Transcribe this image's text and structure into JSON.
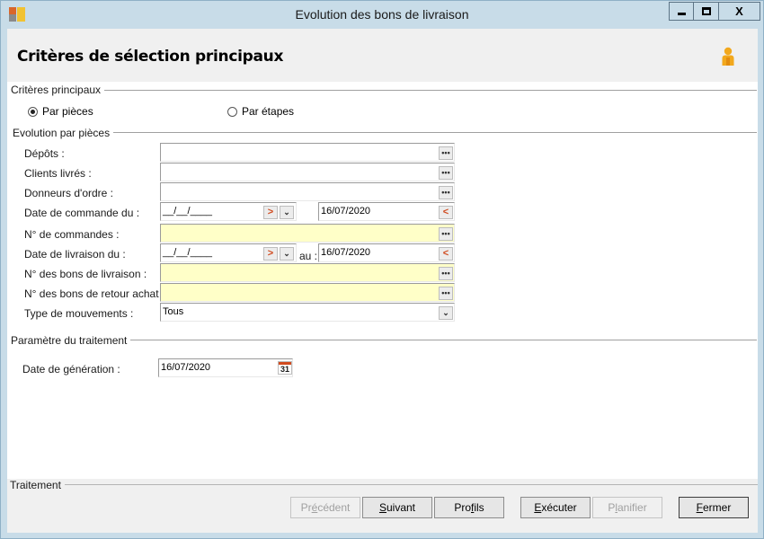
{
  "window": {
    "title": "Evolution des bons de livraison",
    "controls": {
      "minimize": "▬",
      "maximize": "☐",
      "close": "X"
    }
  },
  "header": {
    "title": "Critères de sélection principaux"
  },
  "sections": {
    "main": "Critères principaux",
    "pieces": "Evolution par pièces",
    "params": "Paramètre du traitement",
    "treatment": "Traitement"
  },
  "radios": {
    "par_pieces": {
      "label": "Par pièces",
      "checked": true
    },
    "par_etapes": {
      "label": "Par étapes",
      "checked": false
    }
  },
  "form": {
    "depots": {
      "label": "Dépôts :",
      "value": ""
    },
    "clients": {
      "label": "Clients livrés :",
      "value": ""
    },
    "donneurs": {
      "label": "Donneurs d'ordre :",
      "value": ""
    },
    "date_commande": {
      "label": "Date de commande du :",
      "from": "__/__/____",
      "to": "16/07/2020"
    },
    "num_commandes": {
      "label": "N° de commandes :",
      "value": ""
    },
    "date_livraison": {
      "label": "Date de livraison du :",
      "from": "__/__/____",
      "to_label": "au :",
      "to": "16/07/2020"
    },
    "num_bons_livraison": {
      "label": "N° des bons de livraison :",
      "value": ""
    },
    "num_bons_retour": {
      "label": "N° des bons de retour achat :",
      "value": ""
    },
    "type_mouvements": {
      "label": "Type de mouvements :",
      "value": "Tous"
    },
    "date_generation": {
      "label": "Date de génération :",
      "value": "16/07/2020"
    }
  },
  "icons": {
    "ellipsis": "•••",
    "arrow_right": ">",
    "arrow_left": "<",
    "chevron_down": "⌄",
    "calendar": "31"
  },
  "buttons": {
    "precedent": {
      "pre": "Pr",
      "key": "é",
      "post": "cédent"
    },
    "suivant": {
      "pre": "",
      "key": "S",
      "post": "uivant"
    },
    "profils": {
      "pre": "Pro",
      "key": "f",
      "post": "ils"
    },
    "executer": {
      "pre": "",
      "key": "E",
      "post": "xécuter"
    },
    "planifier": {
      "pre": "P",
      "key": "l",
      "post": "anifier"
    },
    "fermer": {
      "pre": "",
      "key": "F",
      "post": "ermer"
    }
  },
  "colors": {
    "accent": "#d04a1e",
    "highlight_field": "#ffffc8",
    "frame": "#c8dce8"
  }
}
